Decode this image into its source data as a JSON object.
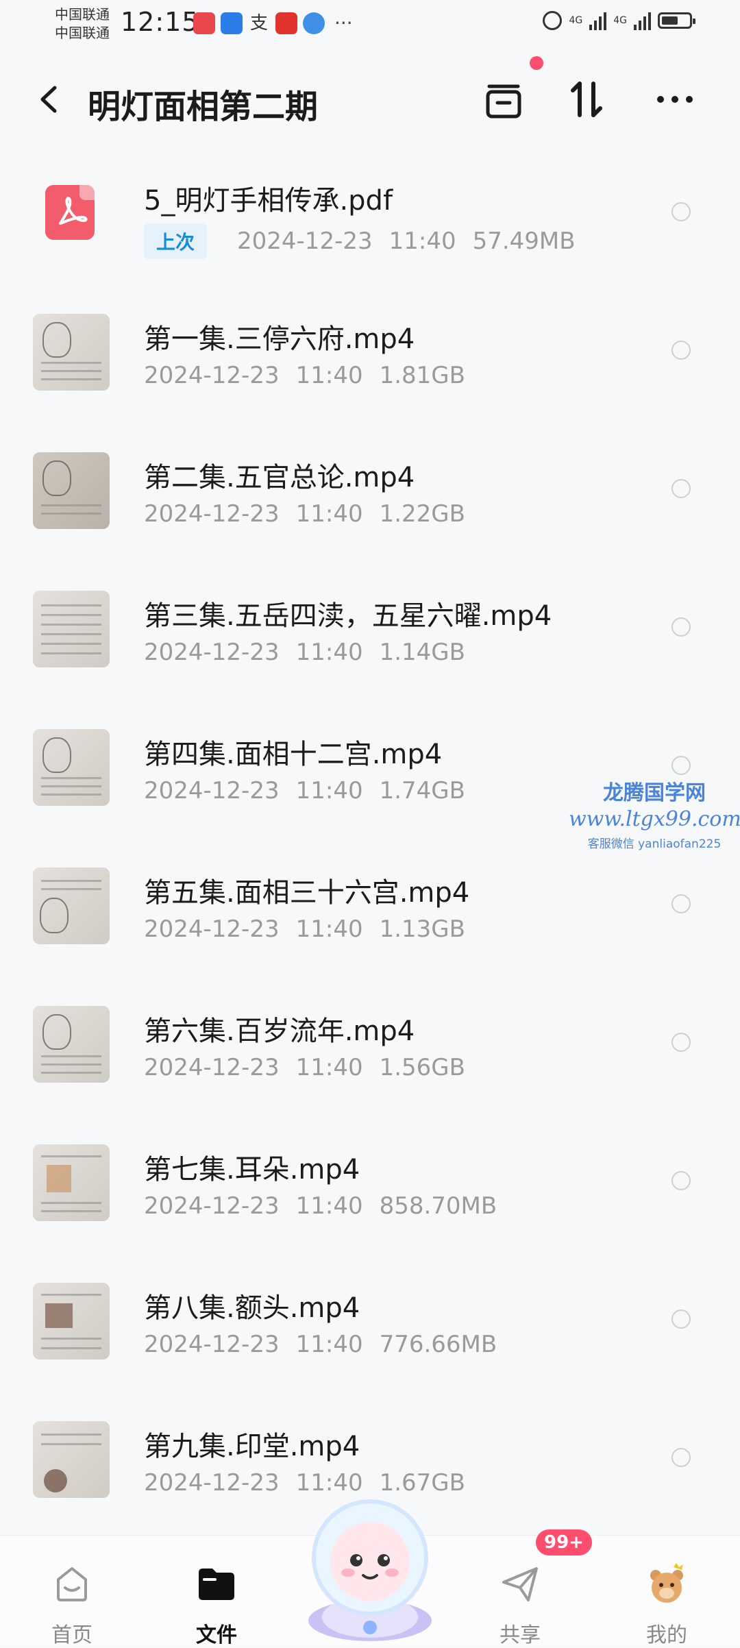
{
  "status_bar": {
    "carrier_1": "中国联通",
    "carrier_2": "中国联通",
    "time": "12:15",
    "network_1": "4G",
    "network_2": "4G",
    "battery_level": 0.6
  },
  "header": {
    "title": "明灯面相第二期"
  },
  "files": [
    {
      "name": "5_明灯手相传承.pdf",
      "tag": "上次",
      "date": "2024-12-23",
      "time": "11:40",
      "size": "57.49MB",
      "icon": "pdf-icon"
    },
    {
      "name": "第一集.三停六府.mp4",
      "date": "2024-12-23",
      "time": "11:40",
      "size": "1.81GB",
      "icon": "video-thumbnail"
    },
    {
      "name": "第二集.五官总论.mp4",
      "date": "2024-12-23",
      "time": "11:40",
      "size": "1.22GB",
      "icon": "video-thumbnail"
    },
    {
      "name": "第三集.五岳四渎，五星六曜.mp4",
      "date": "2024-12-23",
      "time": "11:40",
      "size": "1.14GB",
      "icon": "video-thumbnail"
    },
    {
      "name": "第四集.面相十二宫.mp4",
      "date": "2024-12-23",
      "time": "11:40",
      "size": "1.74GB",
      "icon": "video-thumbnail"
    },
    {
      "name": "第五集.面相三十六宫.mp4",
      "date": "2024-12-23",
      "time": "11:40",
      "size": "1.13GB",
      "icon": "video-thumbnail"
    },
    {
      "name": "第六集.百岁流年.mp4",
      "date": "2024-12-23",
      "time": "11:40",
      "size": "1.56GB",
      "icon": "video-thumbnail"
    },
    {
      "name": "第七集.耳朵.mp4",
      "date": "2024-12-23",
      "time": "11:40",
      "size": "858.70MB",
      "icon": "video-thumbnail"
    },
    {
      "name": "第八集.额头.mp4",
      "date": "2024-12-23",
      "time": "11:40",
      "size": "776.66MB",
      "icon": "video-thumbnail"
    },
    {
      "name": "第九集.印堂.mp4",
      "date": "2024-12-23",
      "time": "11:40",
      "size": "1.67GB",
      "icon": "video-thumbnail"
    }
  ],
  "watermark": {
    "name": "龙腾国学网",
    "url": "www.ltgx99.com",
    "contact": "客服微信 yanliaofan225"
  },
  "bottom_nav": {
    "home": "首页",
    "files": "文件",
    "share": "共享",
    "mine": "我的",
    "share_badge": "99+"
  },
  "colors": {
    "accent": "#ff4d6d",
    "tag_text": "#1a8bd6",
    "pdf": "#f35c6b",
    "watermark": "#4b83d9"
  }
}
